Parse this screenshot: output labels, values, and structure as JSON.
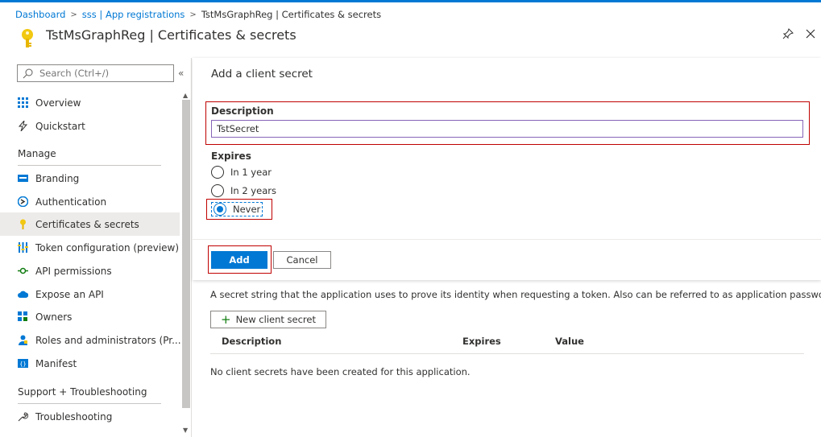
{
  "breadcrumb": {
    "items": [
      "Dashboard",
      "sss | App registrations",
      "TstMsGraphReg | Certificates & secrets"
    ]
  },
  "header": {
    "title": "TstMsGraphReg | Certificates & secrets",
    "icon": "key-icon"
  },
  "sidebar": {
    "search_placeholder": "Search (Ctrl+/)",
    "collapse": "«",
    "items_top": [
      {
        "label": "Overview",
        "icon": "overview-grid-icon"
      },
      {
        "label": "Quickstart",
        "icon": "lightning-icon"
      }
    ],
    "manage_header": "Manage",
    "manage_items": [
      {
        "label": "Branding",
        "icon": "branding-icon"
      },
      {
        "label": "Authentication",
        "icon": "authentication-icon"
      },
      {
        "label": "Certificates & secrets",
        "icon": "key-icon",
        "selected": true
      },
      {
        "label": "Token configuration (preview)",
        "icon": "token-bars-icon"
      },
      {
        "label": "API permissions",
        "icon": "api-permissions-icon"
      },
      {
        "label": "Expose an API",
        "icon": "cloud-icon"
      },
      {
        "label": "Owners",
        "icon": "owners-grid-icon"
      },
      {
        "label": "Roles and administrators (Pr...",
        "icon": "roles-person-icon"
      },
      {
        "label": "Manifest",
        "icon": "manifest-icon"
      }
    ],
    "support_header": "Support + Troubleshooting",
    "support_items": [
      {
        "label": "Troubleshooting",
        "icon": "wrench-icon"
      }
    ]
  },
  "panel": {
    "title": "Add a client secret",
    "description_label": "Description",
    "description_value": "TstSecret",
    "expires_label": "Expires",
    "options": [
      {
        "label": "In 1 year",
        "checked": false
      },
      {
        "label": "In 2 years",
        "checked": false
      },
      {
        "label": "Never",
        "checked": true
      }
    ],
    "add_label": "Add",
    "cancel_label": "Cancel"
  },
  "content": {
    "description": "A secret string that the application uses to prove its identity when requesting a token. Also can be referred to as application password.",
    "new_secret_label": "New client secret",
    "columns": [
      "Description",
      "Expires",
      "Value"
    ],
    "empty_message": "No client secrets have been created for this application."
  },
  "colors": {
    "accent": "#0078d4",
    "highlight": "#c00000",
    "key": "#f2c811"
  }
}
